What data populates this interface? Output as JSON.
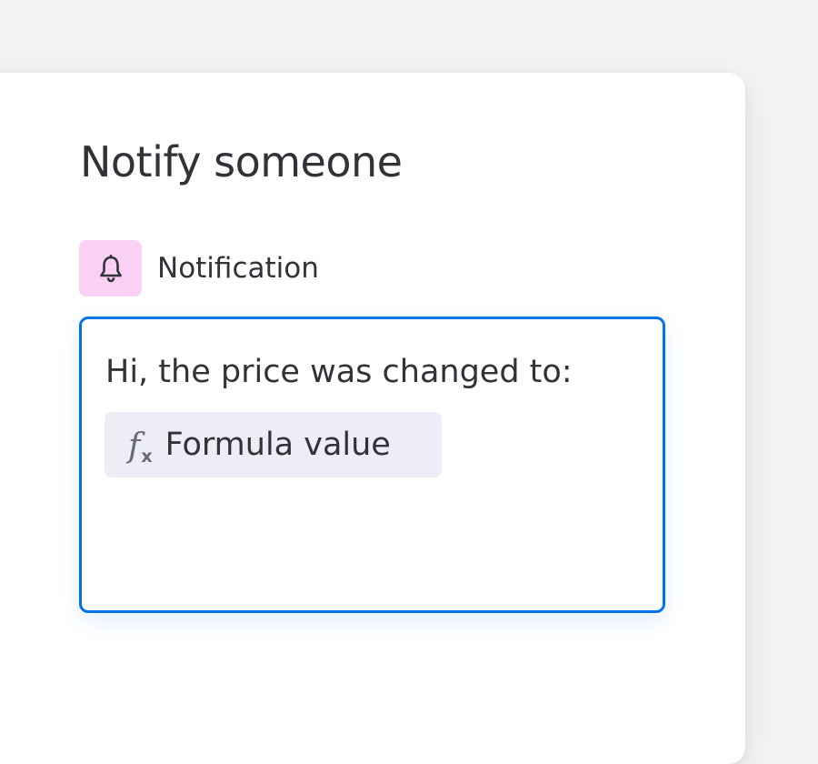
{
  "dialog": {
    "title": "Notify someone"
  },
  "section": {
    "icon": "bell-icon",
    "icon_background": "#fad1f4",
    "label": "Notification"
  },
  "editor": {
    "text": "Hi, the price was changed to:",
    "border_color": "#0073ea",
    "chip": {
      "icon": "formula-icon",
      "icon_f": "f",
      "icon_x": "x",
      "label": "Formula value"
    }
  }
}
